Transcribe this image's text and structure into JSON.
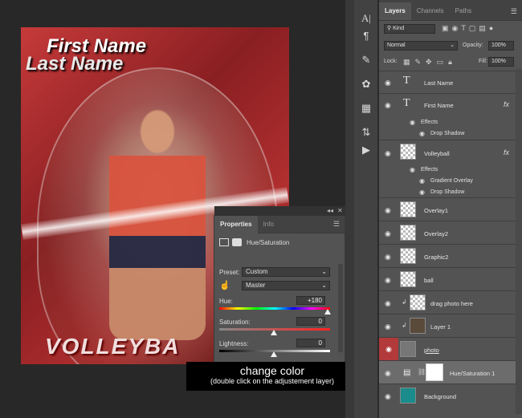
{
  "canvas": {
    "first_name": "First Name",
    "last_name": "Last Name",
    "volleyball_text": "VOLLEYBA"
  },
  "properties_panel": {
    "tabs": [
      "Properties",
      "Info"
    ],
    "title": "Hue/Saturation",
    "preset_label": "Preset:",
    "preset_value": "Custom",
    "channel_value": "Master",
    "hue_label": "Hue:",
    "hue_value": "+180",
    "saturation_label": "Saturation:",
    "saturation_value": "0",
    "lightness_label": "Lightness:",
    "lightness_value": "0"
  },
  "tooltip": {
    "main": "change color",
    "sub": "(double click on the adjustement layer)"
  },
  "layers_panel": {
    "tabs": [
      "Layers",
      "Channels",
      "Paths"
    ],
    "kind_label": "Kind",
    "blend_mode": "Normal",
    "opacity_label": "Opacity:",
    "opacity_value": "100%",
    "lock_label": "Lock:",
    "fill_label": "Fill:",
    "fill_value": "100%",
    "layers": [
      {
        "name": "Last Name"
      },
      {
        "name": "First Name",
        "effects_label": "Effects",
        "effects": [
          "Drop Shadow"
        ]
      },
      {
        "name": "Volleyball",
        "effects_label": "Effects",
        "effects": [
          "Gradient Overlay",
          "Drop Shadow"
        ]
      },
      {
        "name": "Overlay1"
      },
      {
        "name": "Overlay2"
      },
      {
        "name": "Graphic2"
      },
      {
        "name": "ball"
      },
      {
        "name": "drag photo here"
      },
      {
        "name": "Layer 1"
      },
      {
        "name": "photo"
      },
      {
        "name": "Hue/Saturation 1"
      },
      {
        "name": "Background"
      }
    ]
  },
  "colors": {
    "background_layer_thumb": "#1a8c8c",
    "selected_eye": "#b23a3a",
    "panel_bg": "#535353"
  }
}
